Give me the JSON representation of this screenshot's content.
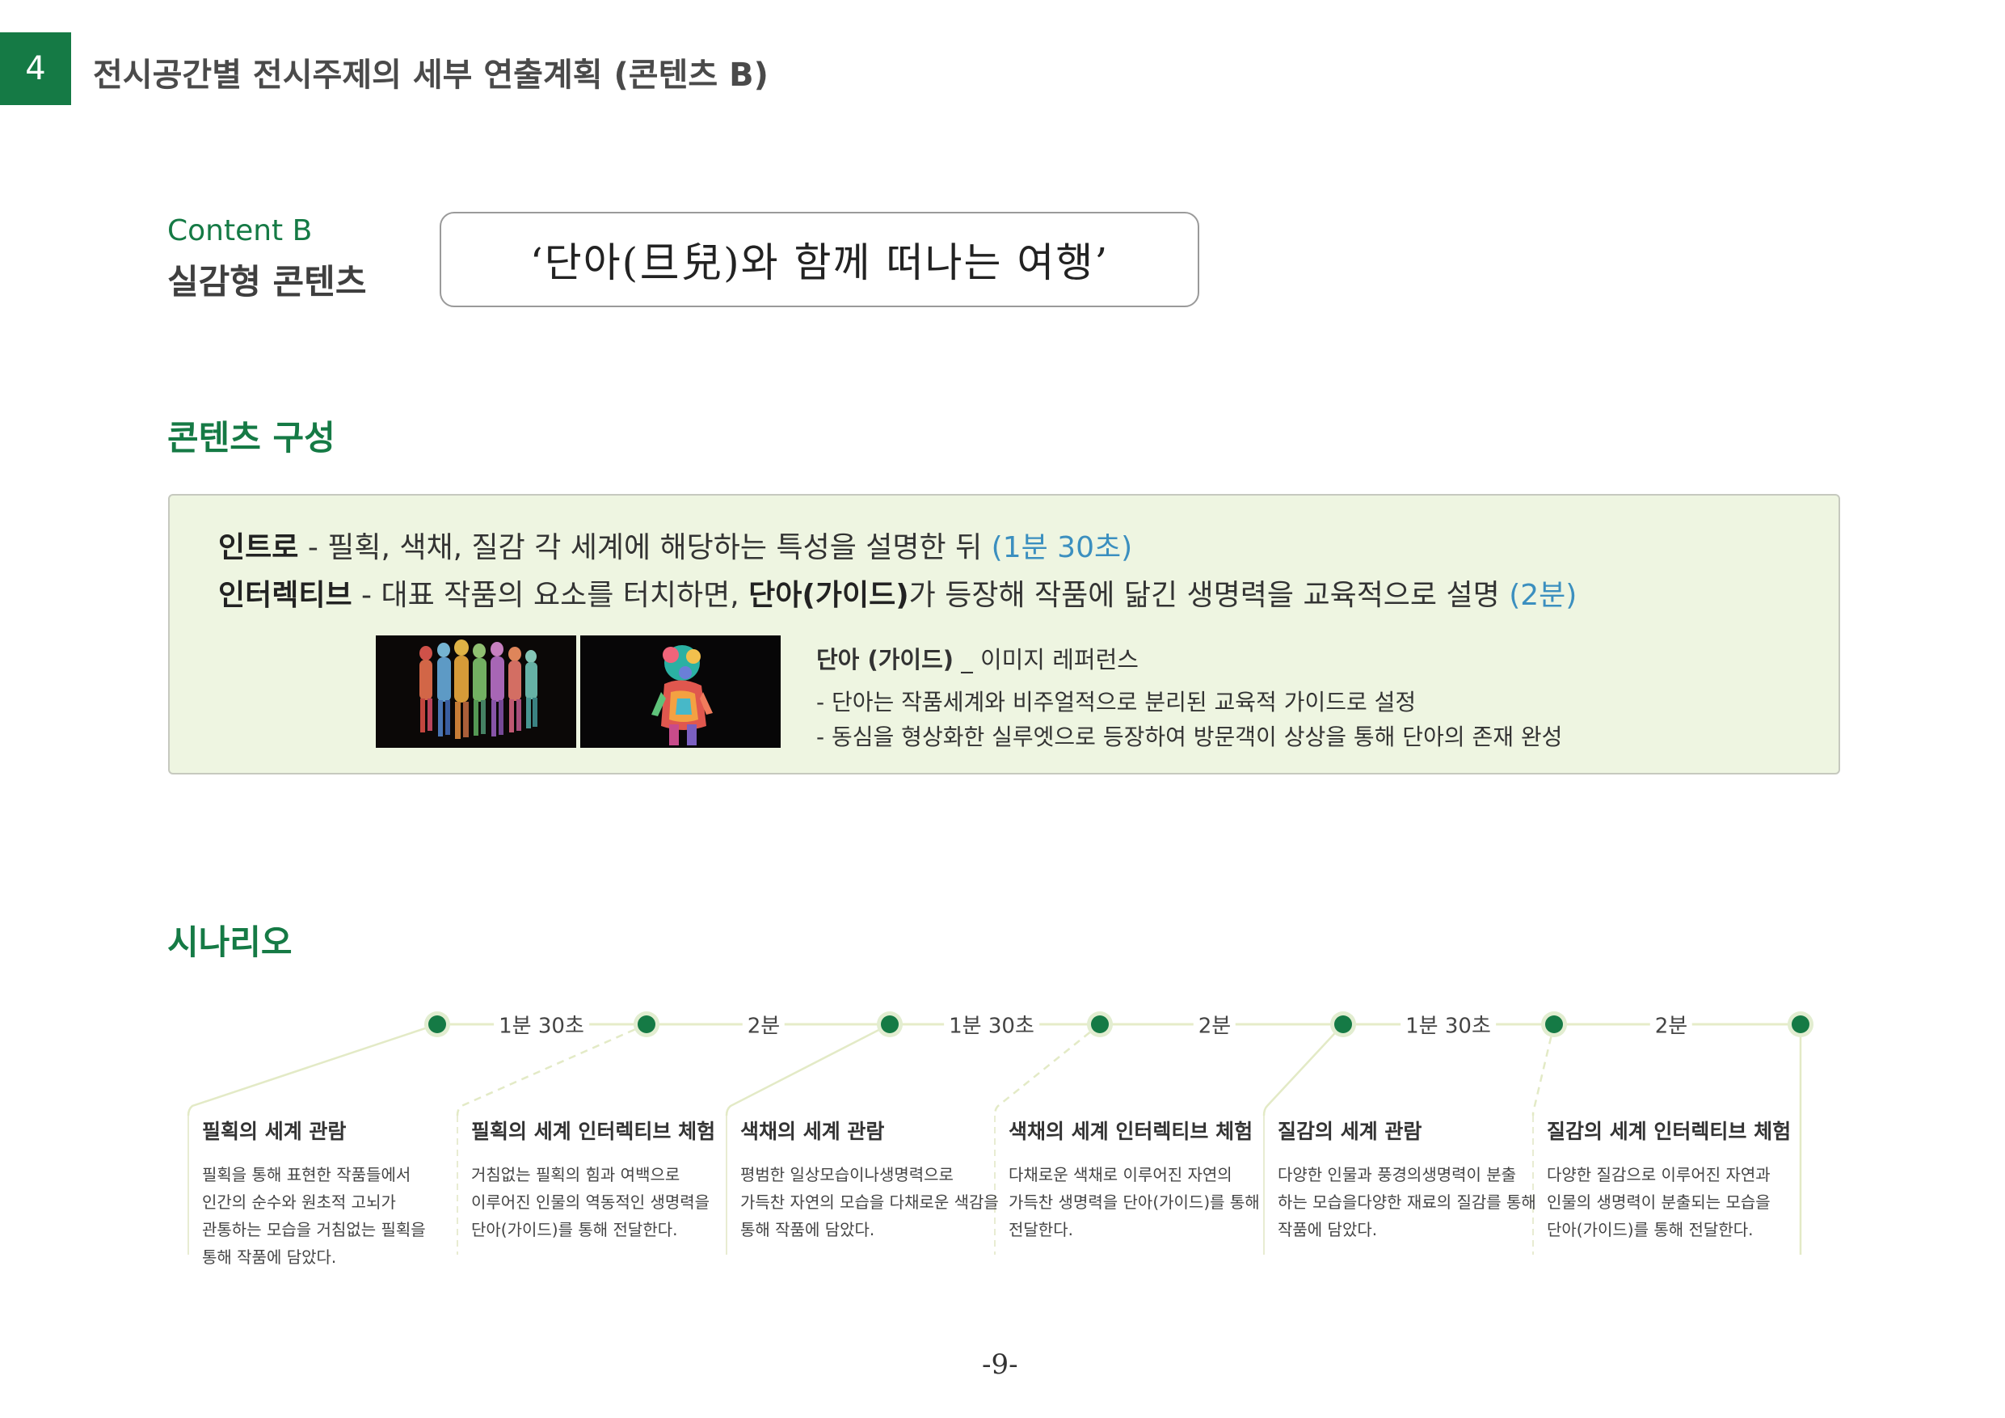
{
  "header": {
    "section_number": "4",
    "section_title": "전시공간별 전시주제의 세부 연출계획 (콘텐츠 B)"
  },
  "content": {
    "label": "Content B",
    "subtitle": "실감형 콘텐츠",
    "title": "‘단아(旦兒)와 함께 떠나는 여행’"
  },
  "composition": {
    "heading": "콘텐츠 구성",
    "intro": {
      "label": "인트로",
      "text": " - 필획, 색채, 질감 각 세계에 해당하는 특성을 설명한 뒤 ",
      "duration": "(1분 30초)"
    },
    "interactive": {
      "label": "인터렉티브",
      "text_a": " - 대표 작품의 요소를  터치하면, ",
      "guide": "단아(가이드)",
      "text_b": "가 등장해 작품에 닮긴 생명력을 교육적으로 설명 ",
      "duration": "(2분)"
    },
    "reference": {
      "title_bold": "단아 (가이드)",
      "title_rest": " _ 이미지 레퍼런스",
      "items": [
        "-    단아는 작품세계와 비주얼적으로 분리된 교육적 가이드로 설정",
        "-    동심을 형상화한 실루엣으로 등장하여 방문객이 상상을 통해 단아의 존재 완성"
      ]
    }
  },
  "scenario": {
    "heading": "시나리오",
    "durations": [
      "1분 30초",
      "2분",
      "1분 30초",
      "2분",
      "1분 30초",
      "2분"
    ],
    "steps": [
      {
        "title": "필획의 세계 관람",
        "desc": "필획을 통해 표현한 작품들에서\n인간의 순수와 원초적 고뇌가\n관통하는 모습을 거침없는 필획을\n통해 작품에 담았다."
      },
      {
        "title": "필획의 세계 인터렉티브 체험",
        "desc": "거침없는 필획의 힘과 여백으로\n이루어진 인물의 역동적인 생명력을\n단아(가이드)를 통해 전달한다."
      },
      {
        "title": "색채의 세계 관람",
        "desc": "평범한 일상모습이나생명력으로\n가득찬 자연의 모습을 다채로운 색감을\n통해 작품에 담았다."
      },
      {
        "title": "색채의 세계 인터렉티브 체험",
        "desc": "다채로운 색채로 이루어진 자연의\n가득찬 생명력을 단아(가이드)를 통해\n전달한다."
      },
      {
        "title": "질감의 세계 관람",
        "desc": "다양한 인물과 풍경의생명력이 분출\n하는 모습을다양한 재료의 질감를 통해\n작품에 담았다."
      },
      {
        "title": "질감의 세계 인터렉티브 체험",
        "desc": "다양한 질감으로 이루어진 자연과\n인물의 생명력이 분출되는 모습을\n단아(가이드)를 통해 전달한다."
      }
    ]
  },
  "page": {
    "number": "-9-"
  },
  "colors": {
    "accent": "#157a45",
    "panel": "#eef5e1",
    "duration_blue": "#3b8fbf",
    "timeline": "#e6ecc8"
  }
}
